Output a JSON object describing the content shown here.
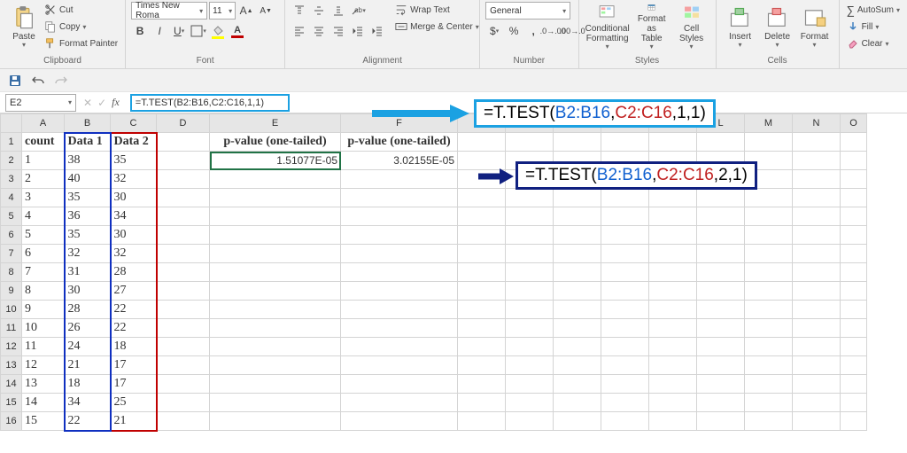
{
  "ribbon": {
    "clipboard": {
      "paste": "Paste",
      "cut": "Cut",
      "copy": "Copy",
      "format_painter": "Format Painter",
      "label": "Clipboard"
    },
    "font": {
      "name": "Times New Roma",
      "size": "11",
      "label": "Font"
    },
    "alignment": {
      "wrap": "Wrap Text",
      "merge": "Merge & Center",
      "label": "Alignment"
    },
    "number": {
      "format": "General",
      "label": "Number"
    },
    "styles": {
      "cond": "Conditional\nFormatting",
      "table": "Format as\nTable",
      "cell": "Cell\nStyles",
      "label": "Styles"
    },
    "cells": {
      "insert": "Insert",
      "delete": "Delete",
      "format": "Format",
      "label": "Cells"
    },
    "editing": {
      "autosum": "AutoSum",
      "fill": "Fill",
      "clear": "Clear"
    }
  },
  "name_box": "E2",
  "formula": "=T.TEST(B2:B16,C2:C16,1,1)",
  "callout1": {
    "p1": "=T.TEST(",
    "p2": "B2:B16",
    "p3": ",",
    "p4": "C2:C16",
    "p5": ",1,1)"
  },
  "callout2": {
    "p1": "=T.TEST(",
    "p2": "B2:B16",
    "p3": ",",
    "p4": "C2:C16",
    "p5": ",2,1)"
  },
  "columns": [
    "A",
    "B",
    "C",
    "D",
    "E",
    "F",
    "G",
    "H",
    "I",
    "J",
    "K",
    "L",
    "M",
    "N",
    "O"
  ],
  "headers": {
    "A": "count",
    "B": "Data 1",
    "C": "Data 2",
    "E": "p-value (one-tailed)",
    "F": "p-value (one-tailed)"
  },
  "results": {
    "E2": "1.51077E-05",
    "F2": "3.02155E-05"
  },
  "rows": [
    {
      "n": "1",
      "a": "1",
      "b": "38",
      "c": "35"
    },
    {
      "n": "2",
      "a": "2",
      "b": "40",
      "c": "32"
    },
    {
      "n": "3",
      "a": "3",
      "b": "35",
      "c": "30"
    },
    {
      "n": "4",
      "a": "4",
      "b": "36",
      "c": "34"
    },
    {
      "n": "5",
      "a": "5",
      "b": "35",
      "c": "30"
    },
    {
      "n": "6",
      "a": "6",
      "b": "32",
      "c": "32"
    },
    {
      "n": "7",
      "a": "7",
      "b": "31",
      "c": "28"
    },
    {
      "n": "8",
      "a": "8",
      "b": "30",
      "c": "27"
    },
    {
      "n": "9",
      "a": "9",
      "b": "28",
      "c": "22"
    },
    {
      "n": "10",
      "a": "10",
      "b": "26",
      "c": "22"
    },
    {
      "n": "11",
      "a": "11",
      "b": "24",
      "c": "18"
    },
    {
      "n": "12",
      "a": "12",
      "b": "21",
      "c": "17"
    },
    {
      "n": "13",
      "a": "13",
      "b": "18",
      "c": "17"
    },
    {
      "n": "14",
      "a": "14",
      "b": "34",
      "c": "25"
    },
    {
      "n": "15",
      "a": "15",
      "b": "22",
      "c": "21"
    }
  ]
}
